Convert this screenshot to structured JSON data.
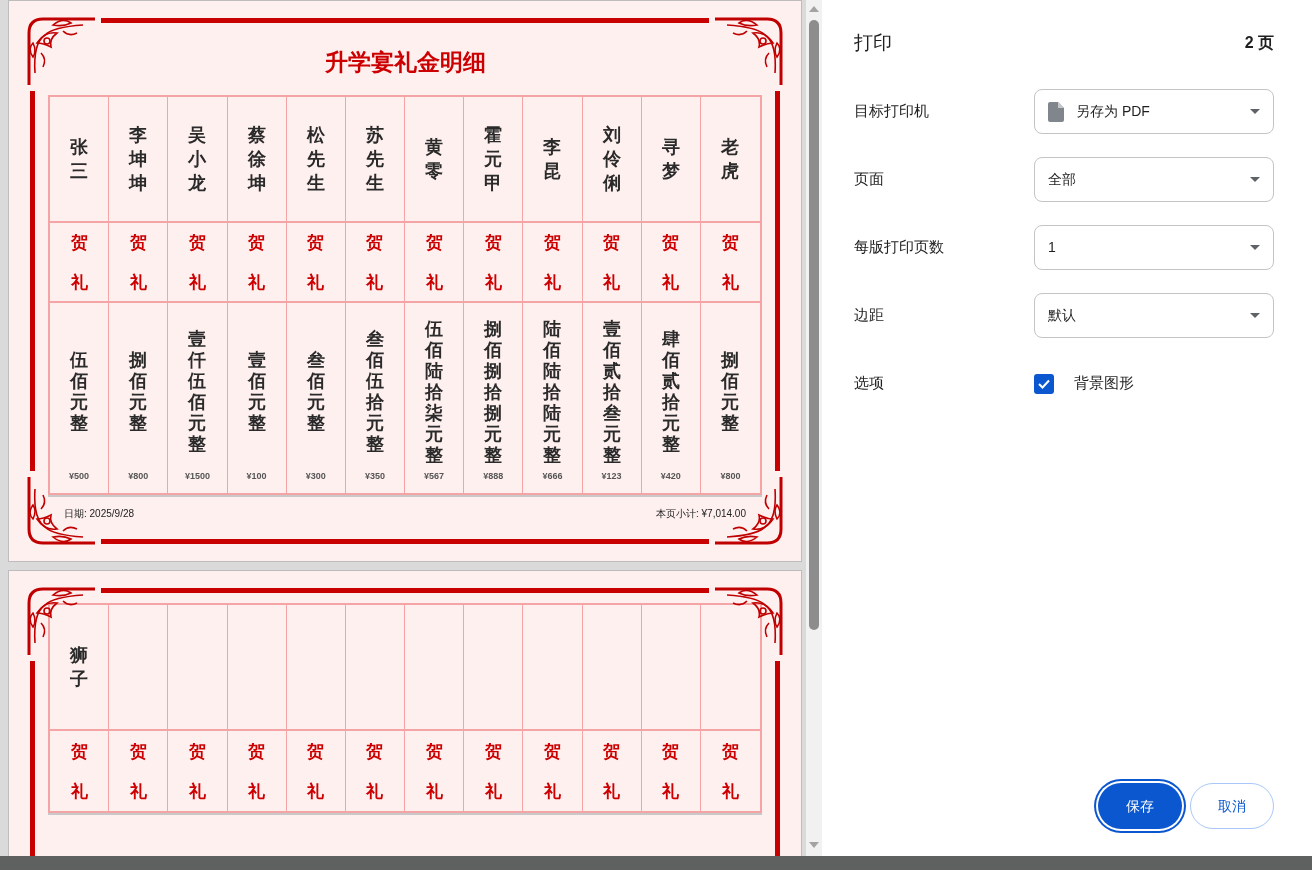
{
  "preview": {
    "pages": [
      {
        "title": "升学宴礼金明细",
        "columns": [
          {
            "name": "张三",
            "greeting": "贺礼",
            "amount_words": "伍佰元整",
            "amount": "¥500"
          },
          {
            "name": "李坤坤",
            "greeting": "贺礼",
            "amount_words": "捌佰元整",
            "amount": "¥800"
          },
          {
            "name": "吴小龙",
            "greeting": "贺礼",
            "amount_words": "壹仟伍佰元整",
            "amount": "¥1500"
          },
          {
            "name": "蔡徐坤",
            "greeting": "贺礼",
            "amount_words": "壹佰元整",
            "amount": "¥100"
          },
          {
            "name": "松先生",
            "greeting": "贺礼",
            "amount_words": "叁佰元整",
            "amount": "¥300"
          },
          {
            "name": "苏先生",
            "greeting": "贺礼",
            "amount_words": "叁佰伍拾元整",
            "amount": "¥350"
          },
          {
            "name": "黄零",
            "greeting": "贺礼",
            "amount_words": "伍佰陆拾柒元整",
            "amount": "¥567"
          },
          {
            "name": "霍元甲",
            "greeting": "贺礼",
            "amount_words": "捌佰捌拾捌元整",
            "amount": "¥888"
          },
          {
            "name": "李昆",
            "greeting": "贺礼",
            "amount_words": "陆佰陆拾陆元整",
            "amount": "¥666"
          },
          {
            "name": "刘伶俐",
            "greeting": "贺礼",
            "amount_words": "壹佰贰拾叁元整",
            "amount": "¥123"
          },
          {
            "name": "寻梦",
            "greeting": "贺礼",
            "amount_words": "肆佰贰拾元整",
            "amount": "¥420"
          },
          {
            "name": "老虎",
            "greeting": "贺礼",
            "amount_words": "捌佰元整",
            "amount": "¥800"
          }
        ],
        "date": "日期: 2025/9/28",
        "subtotal": "本页小计: ¥7,014.00"
      },
      {
        "columns": [
          {
            "name": "狮子",
            "greeting": "贺礼"
          },
          {
            "greeting": "贺礼"
          },
          {
            "greeting": "贺礼"
          },
          {
            "greeting": "贺礼"
          },
          {
            "greeting": "贺礼"
          },
          {
            "greeting": "贺礼"
          },
          {
            "greeting": "贺礼"
          },
          {
            "greeting": "贺礼"
          },
          {
            "greeting": "贺礼"
          },
          {
            "greeting": "贺礼"
          },
          {
            "greeting": "贺礼"
          },
          {
            "greeting": "贺礼"
          }
        ]
      }
    ]
  },
  "print_panel": {
    "title": "打印",
    "page_count": "2 页",
    "settings": [
      {
        "kind": "select",
        "label": "目标打印机",
        "value": "另存为 PDF",
        "icon": true
      },
      {
        "kind": "select",
        "label": "页面",
        "value": "全部"
      },
      {
        "kind": "select",
        "label": "每版打印页数",
        "value": "1"
      },
      {
        "kind": "select",
        "label": "边距",
        "value": "默认"
      },
      {
        "kind": "checkbox",
        "label": "选项",
        "option": "背景图形",
        "checked": true
      }
    ],
    "buttons": [
      {
        "label": "保存",
        "primary": true
      },
      {
        "label": "取消",
        "primary": false
      }
    ]
  }
}
